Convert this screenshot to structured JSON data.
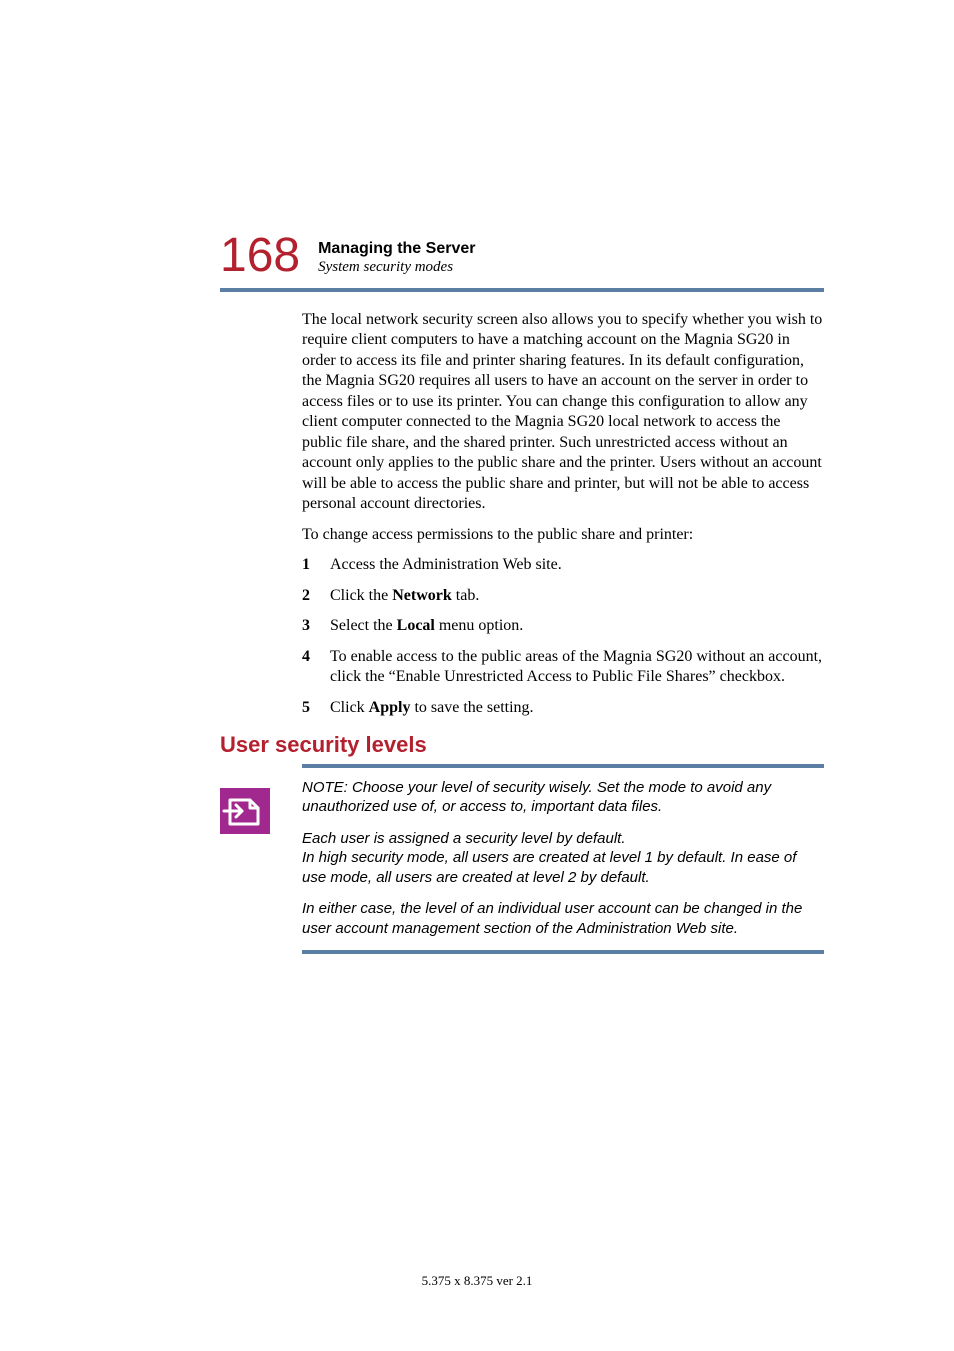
{
  "header": {
    "page_number": "168",
    "chapter_title": "Managing the Server",
    "section_subtitle": "System security modes"
  },
  "body": {
    "paragraph1": "The local network security screen also allows you to specify whether you wish to require client computers to have a matching account on the Magnia SG20 in order to access its file and printer sharing features. In its default configuration, the Magnia SG20 requires all users to have an account on the server in order to access files or to use its printer. You can change this configuration to allow any client computer connected to the Magnia SG20 local network to access the public file share, and the shared printer. Such unrestricted access without an account only applies to the public share and the printer. Users without an account will be able to access the public share and printer, but will not be able to access personal account directories.",
    "paragraph2": "To change access permissions to the public share and printer:",
    "steps": {
      "s1": {
        "num": "1",
        "text": "Access the Administration Web site."
      },
      "s2": {
        "num": "2",
        "prefix": "Click the ",
        "bold": "Network",
        "suffix": " tab."
      },
      "s3": {
        "num": "3",
        "prefix": "Select the ",
        "bold": "Local",
        "suffix": " menu option."
      },
      "s4": {
        "num": "4",
        "text": "To enable access to the public areas of the Magnia SG20 without an account, click the “Enable Unrestricted Access to Public File Shares” checkbox."
      },
      "s5": {
        "num": "5",
        "prefix": "Click ",
        "bold": "Apply",
        "suffix": " to save the setting."
      }
    }
  },
  "section_heading": "User security levels",
  "note": {
    "p1": "NOTE: Choose your level of security wisely. Set the mode to avoid any unauthorized use of, or access to, important data files.",
    "p2_l1": "Each user is assigned a security level by default.",
    "p2_l2": "In high security mode, all users are created at level 1 by default. In ease of use mode, all users are created at level 2 by default.",
    "p3": "In either case, the level of an individual user account can be changed in the user account management section of the Administration Web site."
  },
  "footer": "5.375 x 8.375 ver 2.1"
}
